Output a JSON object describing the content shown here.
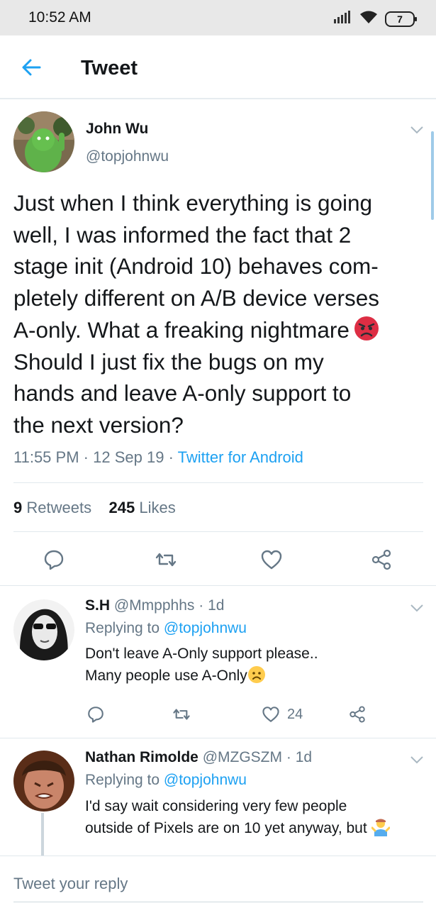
{
  "status_bar": {
    "time": "10:52 AM",
    "battery": "7",
    "icons": [
      "signal-icon",
      "wifi-icon",
      "battery-icon"
    ]
  },
  "app_bar": {
    "title": "Tweet",
    "back_icon": "arrow-left-icon"
  },
  "colors": {
    "accent": "#1da1f2",
    "text": "#14171a",
    "muted": "#657786",
    "divider": "#e1e8ed"
  },
  "tweet": {
    "author_name": "John Wu",
    "author_handle": "@topjohnwu",
    "text_lines": [
      "Just when I think everything is going",
      "well, I was informed the fact that 2",
      "stage init (Android 10) behaves com-",
      "pletely different on A/B device verses",
      "A-only. What a freaking nightmare",
      "Should I just fix the bugs on my",
      "hands and leave A-only support to",
      "the next version?"
    ],
    "emoji": "angry-face-emoji",
    "time": "11:55 PM",
    "date": "12 Sep 19",
    "source": "Twitter for Android",
    "separator": "·",
    "retweets_count": "9",
    "retweets_label": "Retweets",
    "likes_count": "245",
    "likes_label": "Likes"
  },
  "replies": [
    {
      "name": "S.H",
      "handle": "@Mmpphhs",
      "age": "1d",
      "replying_to_label": "Replying to",
      "replying_to": "@topjohnwu",
      "text_lines": [
        "Don't leave A-Only support please..",
        "Many people use A-Only"
      ],
      "emoji": "frowning-face-emoji",
      "likes": "24"
    },
    {
      "name": "Nathan Rimolde",
      "handle": "@MZGSZM",
      "age": "1d",
      "replying_to_label": "Replying to",
      "replying_to": "@topjohnwu",
      "text_lines": [
        "I'd say wait considering very few people",
        "outside of Pixels are on 10 yet anyway, but"
      ],
      "emoji": "person-shrugging-emoji"
    }
  ],
  "compose": {
    "placeholder": "Tweet your reply"
  }
}
